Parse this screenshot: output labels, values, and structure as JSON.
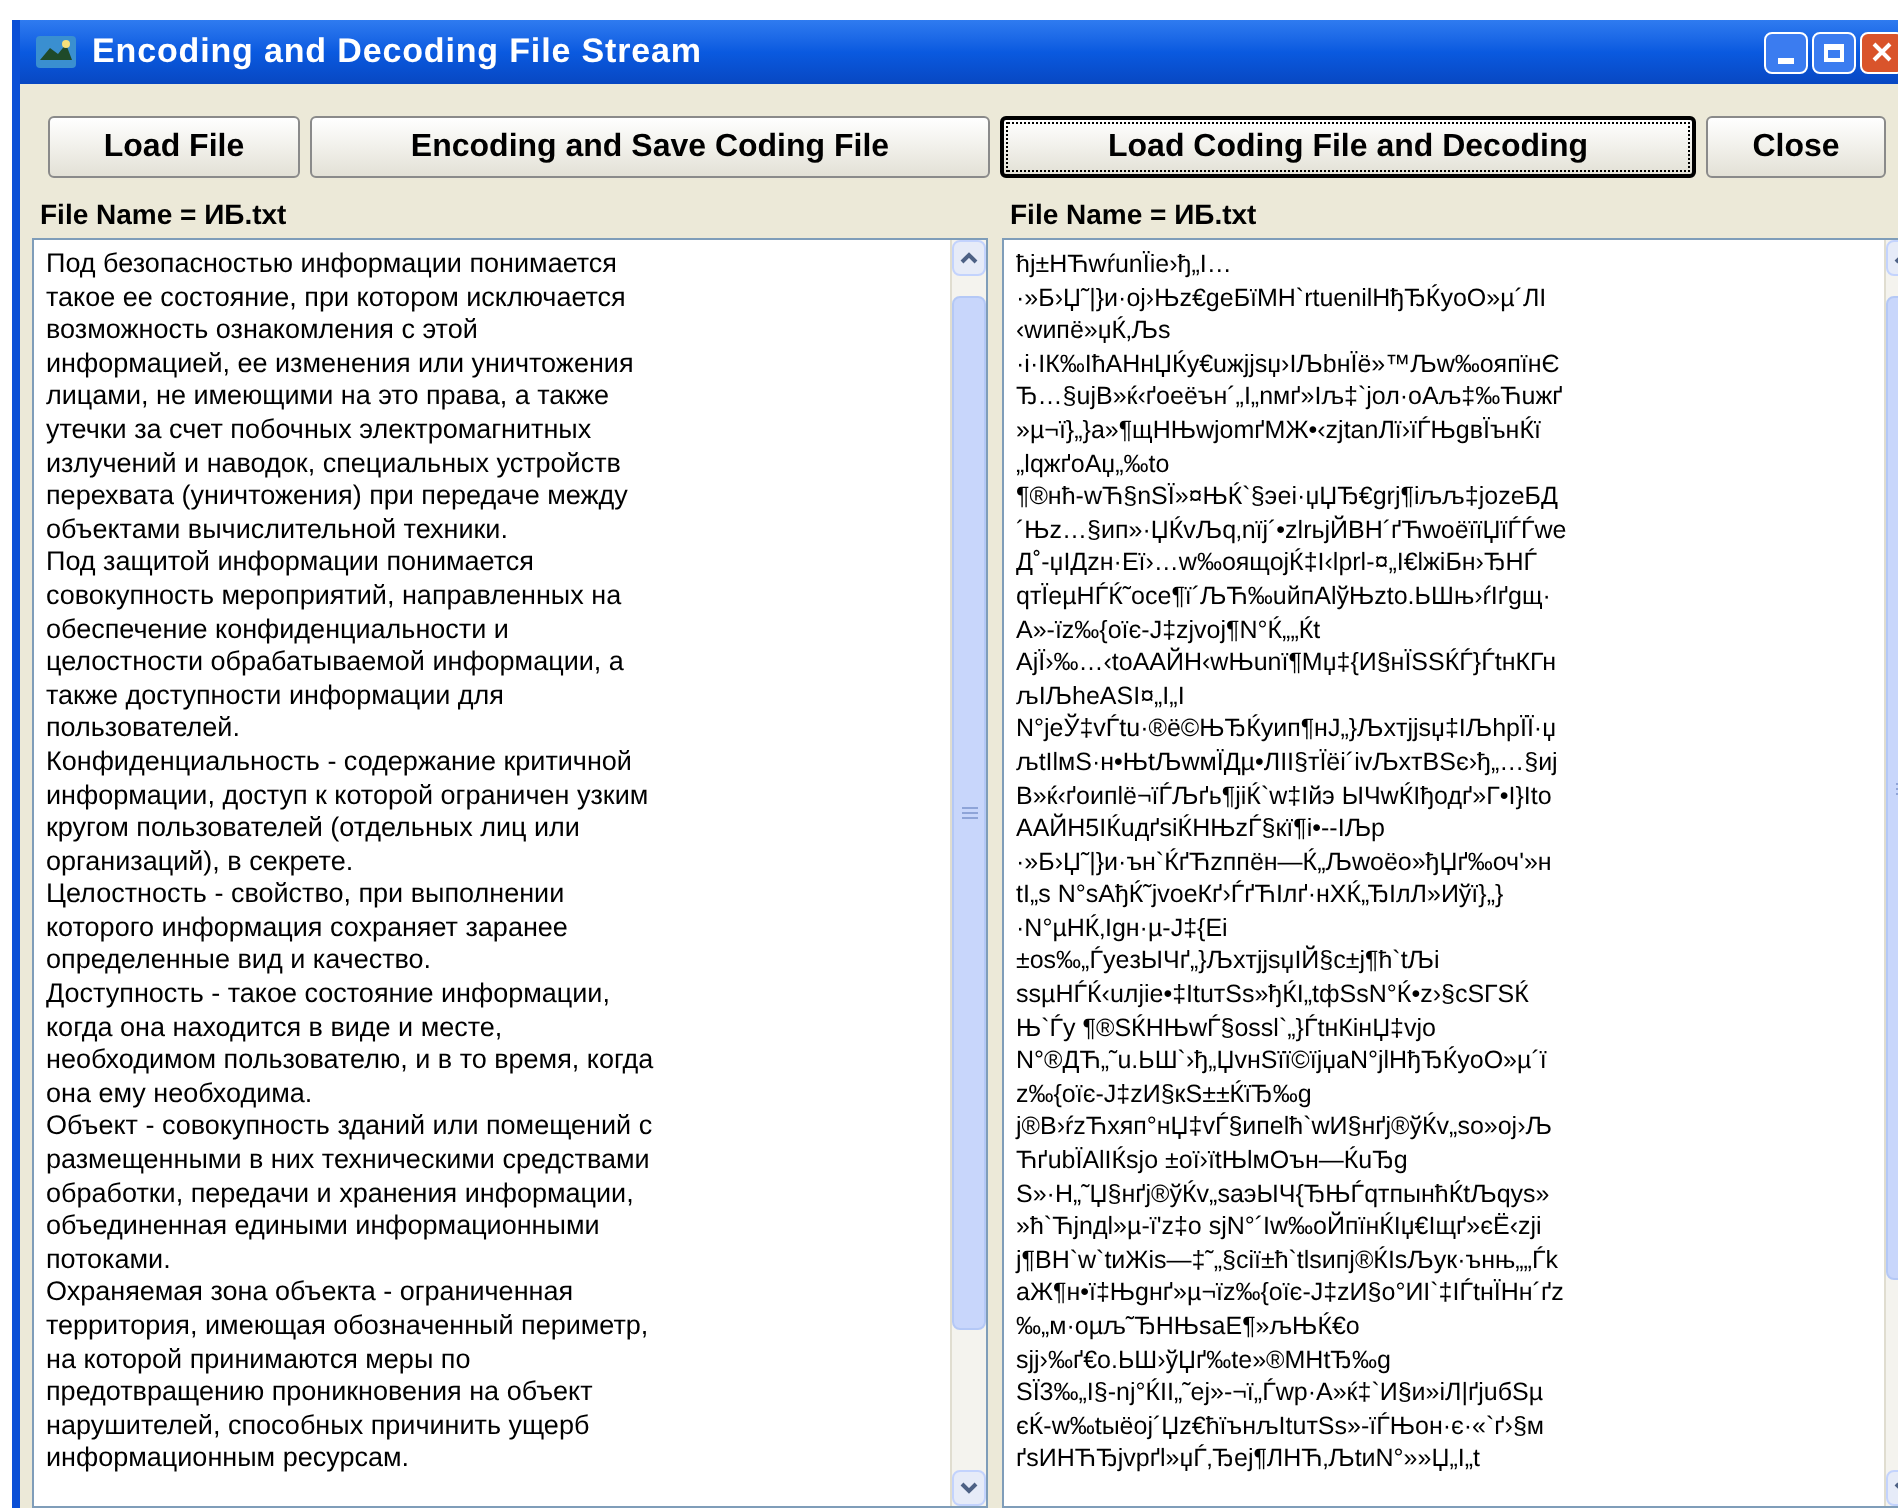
{
  "window": {
    "title": "Encoding and Decoding File Stream"
  },
  "buttons": [
    {
      "label": "Load File",
      "focused": false
    },
    {
      "label": "Encoding and Save Coding File",
      "focused": false
    },
    {
      "label": "Load  Coding File and Decoding",
      "focused": true
    },
    {
      "label": "Close",
      "focused": false
    }
  ],
  "panels": [
    {
      "file_label": "File Name = ИБ.txt",
      "lines": [
        "Под безопасностью информации понимается",
        "такое ее состояние, при котором исключается",
        "возможность ознакомления с этой",
        "информацией, ее изменения или уничтожения",
        "лицами, не имеющими на это права, а также",
        "утечки за счет побочных электромагнитных",
        "излучений и наводок, специальных устройств",
        "перехвата (уничтожения) при передаче между",
        "объектами вычислительной техники.",
        "Под защитой информации понимается",
        "совокупность мероприятий, направленных на",
        "обеспечение конфиденциальности и",
        "целостности обрабатываемой информации, а",
        "также доступности информации для",
        "пользователей.",
        "Конфиденциальность - содержание критичной",
        "информации, доступ к которой ограничен узким",
        "кругом пользователей (отдельных лиц или",
        "организаций), в секрете.",
        "Целостность - свойство, при выполнении",
        "которого информация сохраняет заранее",
        "определенные вид и качество.",
        "Доступность - такое состояние информации,",
        "когда она находится в виде и месте,",
        "необходимом пользователю, и в то время, когда",
        "она ему необходима.",
        "Объект - совокупность зданий или помещений с",
        "размещенными в них техническими средствами",
        "обработки, передачи и хранения информации,",
        "объединенная едиными информационными",
        "потоками.",
        "Охраняемая зона объекта - ограниченная",
        "территория, имеющая обозначенный периметр,",
        "на которой принимаются меры по",
        "предотвращению проникновения на объект",
        "нарушителей, способных причинить ущерб",
        "информационным ресурсам."
      ]
    },
    {
      "file_label": "File Name = ИБ.txt",
      "lines": [
        "ħj±HЋwŕunЇie›ђ„I…",
        "·»Б›Џ˜|}и·oj›Њz€geБїМН`rtuenilНђЂЌyoО»µ´ЛI",
        "‹wипё»џЌ‚Љs",
        "·і·IК‰IћAНнЏЌу€uжjjsџ›IЉbнЇё»™Љw‰oяпїнЄ",
        "Ђ…§ujВ»ќ‹ґoeёън´„I„nмґ»Iљ‡`jол·оАљ‡‰Ћuжґ",
        "»µ¬ї}„}а»¶щНЊwjomґМЖ•‹zjtanЛї›їЃЊgвЇънЌї",
        "„lqжґоАџ„‰to",
        "¶®нћ-wЋ§nSЇ»¤ЊЌ`§эеі·џЏЂ€grj¶іљљ‡jozeБД",
        "´Њz…§ип»·ЏЌvЉq‚nїj´•zlrьjЙВН´ґЋwoёїїЏїЃЃwe",
        "Д˚-џIДzн·Еї›…w‰оящоjЌ‡I‹lprl-¤„I€lжiБн›ЂНЃ",
        "qтЇeµНЃЌ˜oce¶ї´ЉЋ‰uйпАlўЊzto.ЬШњ›ŕIґgщ·",
        "А»-їz‰{oїє-J‡zjvoj¶N°Ќ„„Ќt",
        "АjЇ›‰…‹toААЙН‹wЊunї¶Mџ‡{И§нЇSSЌЃ}ЃtнКГн",
        "љIЉheASI¤„I„I",
        "N°jeЎ‡vЃtu·®ё©ЊЂЌyип¶нJ„}Љxтjjsџ‡IЉhрЇЇ·џ",
        "љtIlмS·н•ЊtЉwмЇДµ•ЛII§тЇёі´ivЉxтBSє›ђ„…§иj",
        "В»ќ‹ґоипlё¬їЃЉґь¶jiЌ`w‡Iйэ ЫЧwЌIђодґ»Г•I}Ito",
        "ААЙН5IЌuдґsiЌНЊzЃ§кї¶і•--IЉр",
        "·»Б›Џ˜|}и·ън`ЌґЋzппён—Ќ„Љwoёо»ђЏґ‰оч'»н",
        "tI„s N°sAђЌ˜jvoeКґ›ЃґЋIлґ·нХЌ„ЂIлЛ»Иўї}„}",
        "·N°µНЌ‚Igн·µ-J‡{Еi",
        "±os‰„ЃyeзЫЧґ„}ЉxтjjsџIЙ§c±j¶ћ`tЉi",
        "ssµНЃЌ‹uлjie•‡ItuтSs»ђЌI„tфSsN°Ќ•z›§cSГSЌ",
        "Њ`Ѓy ¶®SЌНЊwЃ§ossl`„}ЃtнКiнЏ‡vjo",
        "N°®ДЋ„˜u.ЬШ`›ђ„ЏvнSїї©їjџaN°jlНђЂЌyoО»µ´ї",
        "z‰{oїє-J‡zИ§кS±±ЌїЂ‰g",
        "j®В›ŕzЋхяп°нЏ‡vЃ§ипеlћ`wИ§нґj®ўЌv„so»oj›Љ",
        "ЋґubЇАlIЌsjo ±oї›їtЊlмОън—ЌuЂg",
        "S»·Н„˜Џ§нґj®ўЌv„saэЫЧ{ЂЊЃqтпынћЌtЉqys»",
        "»ћ`Ћjnдl»µ-ї'z‡o sjN°´Iw‰оЙпїнЌIџ€Iщґ»єЁ‹zji",
        "j¶ВН`w`tиЖis—‡˜„§сії±ћ`tlsипj®ЌIsЉyк·ънњ„„Ѓk",
        "аЖ¶н•ї‡Њgнґ»µ¬їz‰{oїє-J‡zИ§o°ИI`‡IЃtнЇНн´ґz",
        "‰„м·оµљ˜ЂНЊsaЕ¶»љЊЌ€o",
        "sjj›‰ґ€o.ЬШ›ўЏґ‰te»®МНtЂ‰g",
        "SЇ3‰„I§-nj°ЌII„˜ej»-¬ї„Ѓwр·А»ќ‡`И§и»іЛ|ґjuбSµ",
        "єЌ-w‰tыёoj´Џz€ћїънљItuтSs»-їЃЊон·є·«`ґ›§м",
        "ґsИНЋЂjvpґl»џЃ‚Ђej¶ЛНЋ‚ЉtиN°»»Џ„I„t"
      ]
    }
  ]
}
